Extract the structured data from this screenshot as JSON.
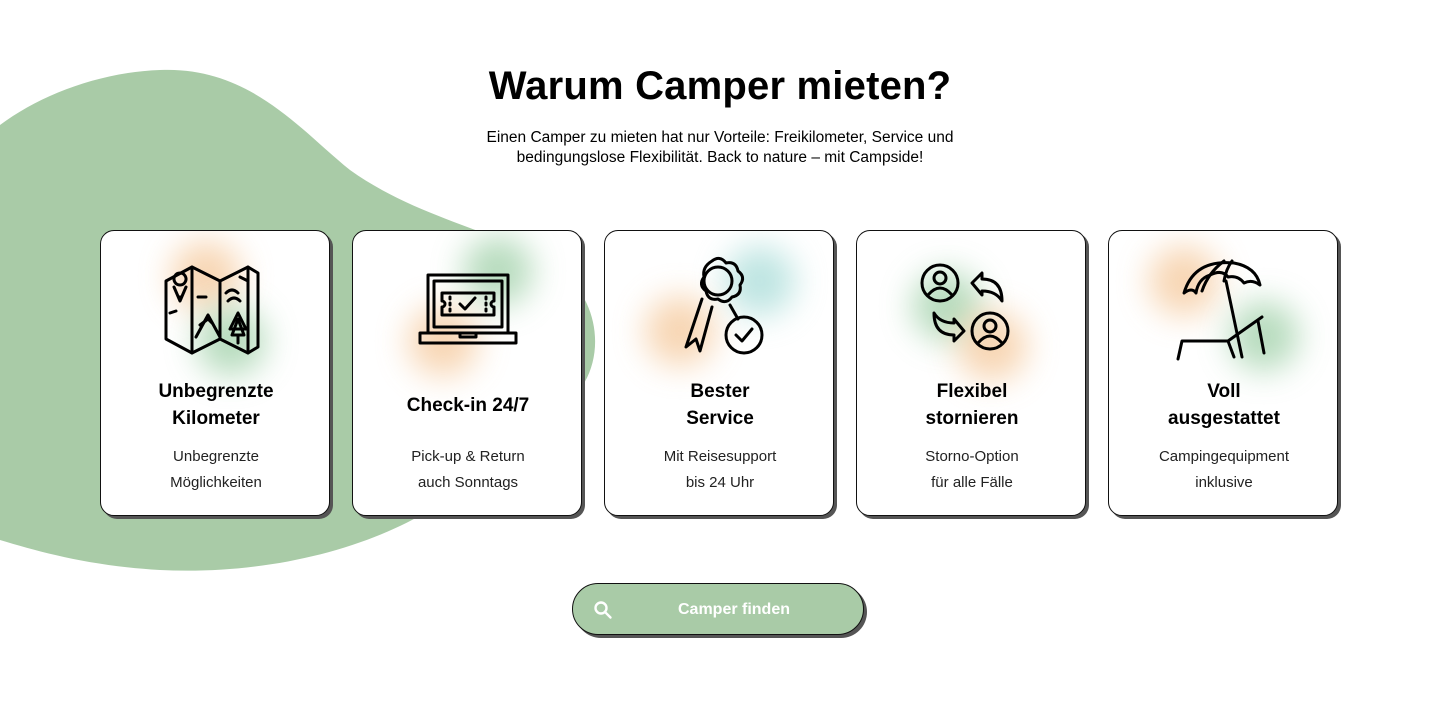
{
  "heading": "Warum Camper mieten?",
  "intro": {
    "line1": "Einen Camper zu mieten hat nur Vorteile: Freikilometer, Service und",
    "line2": "bedingungslose Flexibilität. Back to nature – mit Campside!"
  },
  "colors": {
    "accent": "#a9cba7",
    "glow_orange": "#f5c89a",
    "glow_green": "#9fd0a8",
    "glow_teal": "#a8dcd8"
  },
  "cards": [
    {
      "icon": "map-icon",
      "title_lines": [
        "Unbegrenzte",
        "Kilometer"
      ],
      "text_lines": [
        "Unbegrenzte",
        "Möglichkeiten"
      ]
    },
    {
      "icon": "laptop-ticket-icon",
      "title_lines": [
        "Check-in 24/7"
      ],
      "text_lines": [
        "Pick-up & Return",
        "auch Sonntags"
      ]
    },
    {
      "icon": "award-icon",
      "title_lines": [
        "Bester",
        "Service"
      ],
      "text_lines": [
        "Mit Reisesupport",
        "bis 24 Uhr"
      ]
    },
    {
      "icon": "user-swap-icon",
      "title_lines": [
        "Flexibel",
        "stornieren"
      ],
      "text_lines": [
        "Storno-Option",
        "für alle Fälle"
      ]
    },
    {
      "icon": "beach-chair-icon",
      "title_lines": [
        "Voll",
        "ausgestattet"
      ],
      "text_lines": [
        "Campingequipment",
        "inklusive"
      ]
    }
  ],
  "cta": {
    "label": "Camper finden",
    "icon": "search-icon"
  }
}
